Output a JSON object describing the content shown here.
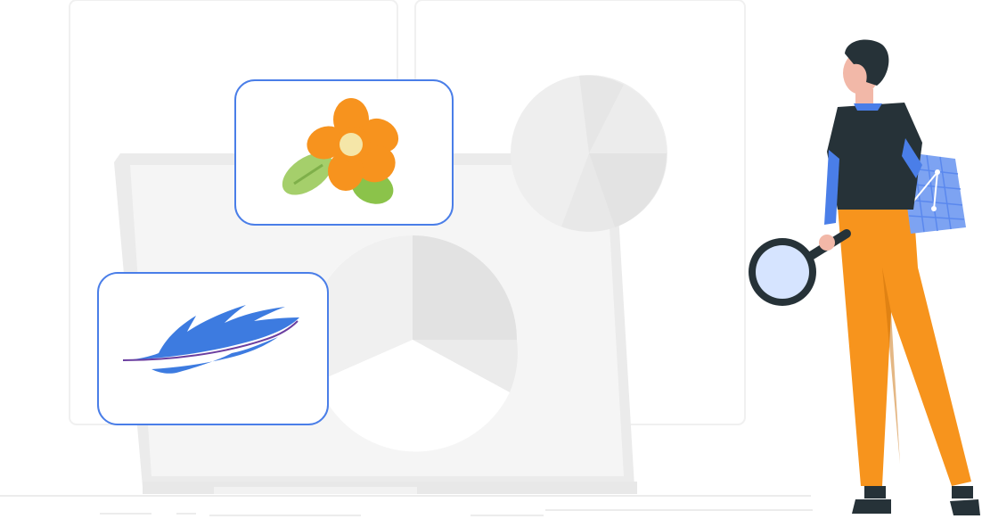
{
  "illustration": {
    "subject": "",
    "colors": {
      "panel_border": "#efefef",
      "screen_fill": "#f5f5f5",
      "screen_frame": "#ebebeb",
      "pie_light": "#f0f0f0",
      "pie_mid": "#e6e6e6",
      "pie_dark": "#dcdcdc",
      "card_border": "#4a7ee8",
      "flower_petal": "#f7931e",
      "flower_center": "#f5e6a8",
      "leaf": "#8bc34a",
      "feather": "#3d7be0",
      "shirt": "#263238",
      "pants": "#f7941d",
      "skin": "#f2b8a8",
      "hair": "#263238",
      "magnifier_lens": "#d6e4ff",
      "grid_sheet": "#7da3f2"
    },
    "icons": [
      "flower-icon",
      "feather-icon",
      "pie-chart-icon",
      "magnifying-glass-icon"
    ]
  }
}
